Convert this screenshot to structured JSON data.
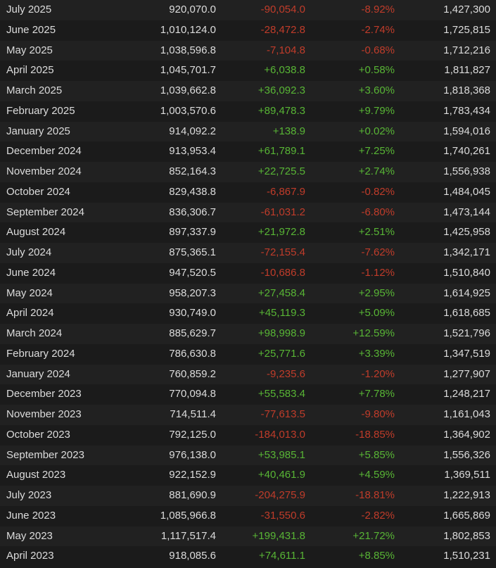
{
  "colors": {
    "background": "#1b1b1b",
    "row_alt": "#212121",
    "text": "#dcdcdc",
    "positive": "#58b535",
    "negative": "#c03c2a"
  },
  "rows": [
    {
      "month": "July 2025",
      "avg": "920,070.0",
      "gain": "-90,054.0",
      "pct": "-8.92%",
      "peak": "1,427,300",
      "trend": "neg"
    },
    {
      "month": "June 2025",
      "avg": "1,010,124.0",
      "gain": "-28,472.8",
      "pct": "-2.74%",
      "peak": "1,725,815",
      "trend": "neg"
    },
    {
      "month": "May 2025",
      "avg": "1,038,596.8",
      "gain": "-7,104.8",
      "pct": "-0.68%",
      "peak": "1,712,216",
      "trend": "neg"
    },
    {
      "month": "April 2025",
      "avg": "1,045,701.7",
      "gain": "+6,038.8",
      "pct": "+0.58%",
      "peak": "1,811,827",
      "trend": "pos"
    },
    {
      "month": "March 2025",
      "avg": "1,039,662.8",
      "gain": "+36,092.3",
      "pct": "+3.60%",
      "peak": "1,818,368",
      "trend": "pos"
    },
    {
      "month": "February 2025",
      "avg": "1,003,570.6",
      "gain": "+89,478.3",
      "pct": "+9.79%",
      "peak": "1,783,434",
      "trend": "pos"
    },
    {
      "month": "January 2025",
      "avg": "914,092.2",
      "gain": "+138.9",
      "pct": "+0.02%",
      "peak": "1,594,016",
      "trend": "pos"
    },
    {
      "month": "December 2024",
      "avg": "913,953.4",
      "gain": "+61,789.1",
      "pct": "+7.25%",
      "peak": "1,740,261",
      "trend": "pos"
    },
    {
      "month": "November 2024",
      "avg": "852,164.3",
      "gain": "+22,725.5",
      "pct": "+2.74%",
      "peak": "1,556,938",
      "trend": "pos"
    },
    {
      "month": "October 2024",
      "avg": "829,438.8",
      "gain": "-6,867.9",
      "pct": "-0.82%",
      "peak": "1,484,045",
      "trend": "neg"
    },
    {
      "month": "September 2024",
      "avg": "836,306.7",
      "gain": "-61,031.2",
      "pct": "-6.80%",
      "peak": "1,473,144",
      "trend": "neg"
    },
    {
      "month": "August 2024",
      "avg": "897,337.9",
      "gain": "+21,972.8",
      "pct": "+2.51%",
      "peak": "1,425,958",
      "trend": "pos"
    },
    {
      "month": "July 2024",
      "avg": "875,365.1",
      "gain": "-72,155.4",
      "pct": "-7.62%",
      "peak": "1,342,171",
      "trend": "neg"
    },
    {
      "month": "June 2024",
      "avg": "947,520.5",
      "gain": "-10,686.8",
      "pct": "-1.12%",
      "peak": "1,510,840",
      "trend": "neg"
    },
    {
      "month": "May 2024",
      "avg": "958,207.3",
      "gain": "+27,458.4",
      "pct": "+2.95%",
      "peak": "1,614,925",
      "trend": "pos"
    },
    {
      "month": "April 2024",
      "avg": "930,749.0",
      "gain": "+45,119.3",
      "pct": "+5.09%",
      "peak": "1,618,685",
      "trend": "pos"
    },
    {
      "month": "March 2024",
      "avg": "885,629.7",
      "gain": "+98,998.9",
      "pct": "+12.59%",
      "peak": "1,521,796",
      "trend": "pos"
    },
    {
      "month": "February 2024",
      "avg": "786,630.8",
      "gain": "+25,771.6",
      "pct": "+3.39%",
      "peak": "1,347,519",
      "trend": "pos"
    },
    {
      "month": "January 2024",
      "avg": "760,859.2",
      "gain": "-9,235.6",
      "pct": "-1.20%",
      "peak": "1,277,907",
      "trend": "neg"
    },
    {
      "month": "December 2023",
      "avg": "770,094.8",
      "gain": "+55,583.4",
      "pct": "+7.78%",
      "peak": "1,248,217",
      "trend": "pos"
    },
    {
      "month": "November 2023",
      "avg": "714,511.4",
      "gain": "-77,613.5",
      "pct": "-9.80%",
      "peak": "1,161,043",
      "trend": "neg"
    },
    {
      "month": "October 2023",
      "avg": "792,125.0",
      "gain": "-184,013.0",
      "pct": "-18.85%",
      "peak": "1,364,902",
      "trend": "neg"
    },
    {
      "month": "September 2023",
      "avg": "976,138.0",
      "gain": "+53,985.1",
      "pct": "+5.85%",
      "peak": "1,556,326",
      "trend": "pos"
    },
    {
      "month": "August 2023",
      "avg": "922,152.9",
      "gain": "+40,461.9",
      "pct": "+4.59%",
      "peak": "1,369,511",
      "trend": "pos"
    },
    {
      "month": "July 2023",
      "avg": "881,690.9",
      "gain": "-204,275.9",
      "pct": "-18.81%",
      "peak": "1,222,913",
      "trend": "neg"
    },
    {
      "month": "June 2023",
      "avg": "1,085,966.8",
      "gain": "-31,550.6",
      "pct": "-2.82%",
      "peak": "1,665,869",
      "trend": "neg"
    },
    {
      "month": "May 2023",
      "avg": "1,117,517.4",
      "gain": "+199,431.8",
      "pct": "+21.72%",
      "peak": "1,802,853",
      "trend": "pos"
    },
    {
      "month": "April 2023",
      "avg": "918,085.6",
      "gain": "+74,611.1",
      "pct": "+8.85%",
      "peak": "1,510,231",
      "trend": "pos"
    }
  ]
}
